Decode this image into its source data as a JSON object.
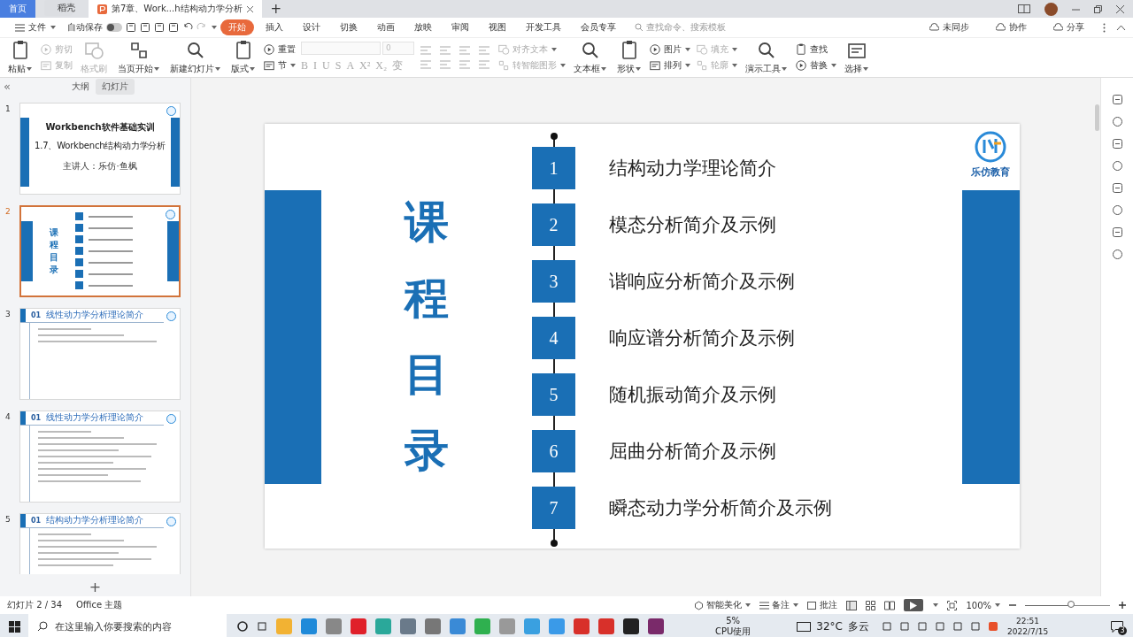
{
  "tabs": [
    {
      "label": "首页",
      "kind": "home",
      "selected": false
    },
    {
      "label": "稻壳",
      "kind": "app",
      "selected": false
    },
    {
      "label": "第7章、Work...h结构动力学分析",
      "kind": "doc",
      "selected": true
    }
  ],
  "new_tab": "+",
  "menu": {
    "file": "文件",
    "autosave": {
      "label": "自动保存",
      "on": false
    },
    "tabs": [
      {
        "label": "开始",
        "selected": true
      },
      {
        "label": "插入",
        "selected": false
      },
      {
        "label": "设计",
        "selected": false
      },
      {
        "label": "切换",
        "selected": false
      },
      {
        "label": "动画",
        "selected": false
      },
      {
        "label": "放映",
        "selected": false
      },
      {
        "label": "审阅",
        "selected": false
      },
      {
        "label": "视图",
        "selected": false
      },
      {
        "label": "开发工具",
        "selected": false
      },
      {
        "label": "会员专享",
        "selected": false
      }
    ],
    "search": {
      "placeholder": "查找命令、搜索模板"
    },
    "actions": [
      "未同步",
      "协作",
      "分享"
    ]
  },
  "ribbon": [
    {
      "kind": "big",
      "label": "粘贴",
      "disabled": false,
      "dropdown": true
    },
    {
      "kind": "stack",
      "items": [
        {
          "label": "剪切",
          "disabled": true,
          "dropdown": false
        },
        {
          "label": "复制",
          "disabled": true,
          "dropdown": false
        }
      ]
    },
    {
      "kind": "big",
      "label": "格式刷",
      "disabled": true,
      "dropdown": false
    },
    {
      "kind": "big",
      "label": "当页开始",
      "disabled": false,
      "dropdown": true
    },
    {
      "kind": "big",
      "label": "新建幻灯片",
      "disabled": false,
      "dropdown": true
    },
    {
      "kind": "big",
      "label": "版式",
      "disabled": false,
      "dropdown": true
    },
    {
      "kind": "stack",
      "items": [
        {
          "label": "重置",
          "disabled": false,
          "dropdown": false
        },
        {
          "label": "节",
          "disabled": false,
          "dropdown": true
        }
      ]
    },
    {
      "kind": "font",
      "size": "0",
      "glyphs": [
        "B",
        "I",
        "U",
        "S",
        "A",
        "X²",
        "X₂",
        "变"
      ]
    },
    {
      "kind": "paragraph"
    },
    {
      "kind": "stack",
      "items": [
        {
          "label": "对齐文本",
          "disabled": true,
          "dropdown": true
        },
        {
          "label": "转智能图形",
          "disabled": true,
          "dropdown": true
        }
      ]
    },
    {
      "kind": "big",
      "label": "文本框",
      "disabled": false,
      "dropdown": true
    },
    {
      "kind": "big",
      "label": "形状",
      "disabled": false,
      "dropdown": true
    },
    {
      "kind": "stack",
      "items": [
        {
          "label": "图片",
          "disabled": false,
          "dropdown": true
        },
        {
          "label": "排列",
          "disabled": false,
          "dropdown": true
        }
      ]
    },
    {
      "kind": "stack",
      "items": [
        {
          "label": "填充",
          "disabled": true,
          "dropdown": true
        },
        {
          "label": "轮廓",
          "disabled": true,
          "dropdown": true
        }
      ]
    },
    {
      "kind": "big",
      "label": "演示工具",
      "disabled": false,
      "dropdown": true
    },
    {
      "kind": "stack",
      "items": [
        {
          "label": "查找",
          "disabled": false,
          "dropdown": false
        },
        {
          "label": "替换",
          "disabled": false,
          "dropdown": true
        }
      ]
    },
    {
      "kind": "big",
      "label": "选择",
      "disabled": false,
      "dropdown": true
    }
  ],
  "panel": {
    "collapse": "«",
    "tabs": [
      {
        "label": "大纲",
        "selected": false
      },
      {
        "label": "幻灯片",
        "selected": true
      }
    ],
    "slides": [
      {
        "number": "1",
        "kind": "cover",
        "selected": false,
        "title": "Workbench软件基础实训",
        "subtitle": "1.7、Workbench结构动力学分析",
        "speaker": "主讲人：乐仿·鱼枫"
      },
      {
        "number": "2",
        "kind": "contents",
        "selected": true,
        "title": "课程目录"
      },
      {
        "number": "3",
        "kind": "section",
        "selected": false,
        "index": "01",
        "title": "线性动力学分析理论简介"
      },
      {
        "number": "4",
        "kind": "section",
        "selected": false,
        "index": "01",
        "title": "线性动力学分析理论简介"
      },
      {
        "number": "5",
        "kind": "section",
        "selected": false,
        "index": "01",
        "title": "结构动力学分析理论简介"
      }
    ],
    "add": "+"
  },
  "slide": {
    "title_chars": [
      "课",
      "程",
      "目",
      "录"
    ],
    "logo_text": "乐仿教育",
    "items": [
      {
        "number": "1",
        "label": "结构动力学理论简介"
      },
      {
        "number": "2",
        "label": "模态分析简介及示例"
      },
      {
        "number": "3",
        "label": "谐响应分析简介及示例"
      },
      {
        "number": "4",
        "label": "响应谱分析简介及示例"
      },
      {
        "number": "5",
        "label": "随机振动简介及示例"
      },
      {
        "number": "6",
        "label": "屈曲分析简介及示例"
      },
      {
        "number": "7",
        "label": "瞬态动力学分析简介及示例"
      }
    ]
  },
  "status_bar": {
    "slide_count": "幻灯片 2 / 34",
    "theme": "Office 主题",
    "beautify": "智能美化",
    "notes": "备注",
    "comments": "批注",
    "zoom": "100%",
    "zoom_slider": {
      "level": 0.55
    }
  },
  "taskbar": {
    "search": {
      "placeholder": "在这里输入你要搜索的内容"
    },
    "cpu": [
      "5%",
      "CPU使用"
    ],
    "weather": [
      "32°C",
      "多云"
    ],
    "time": "22:51",
    "date": "2022/7/15",
    "notifications": "3"
  }
}
